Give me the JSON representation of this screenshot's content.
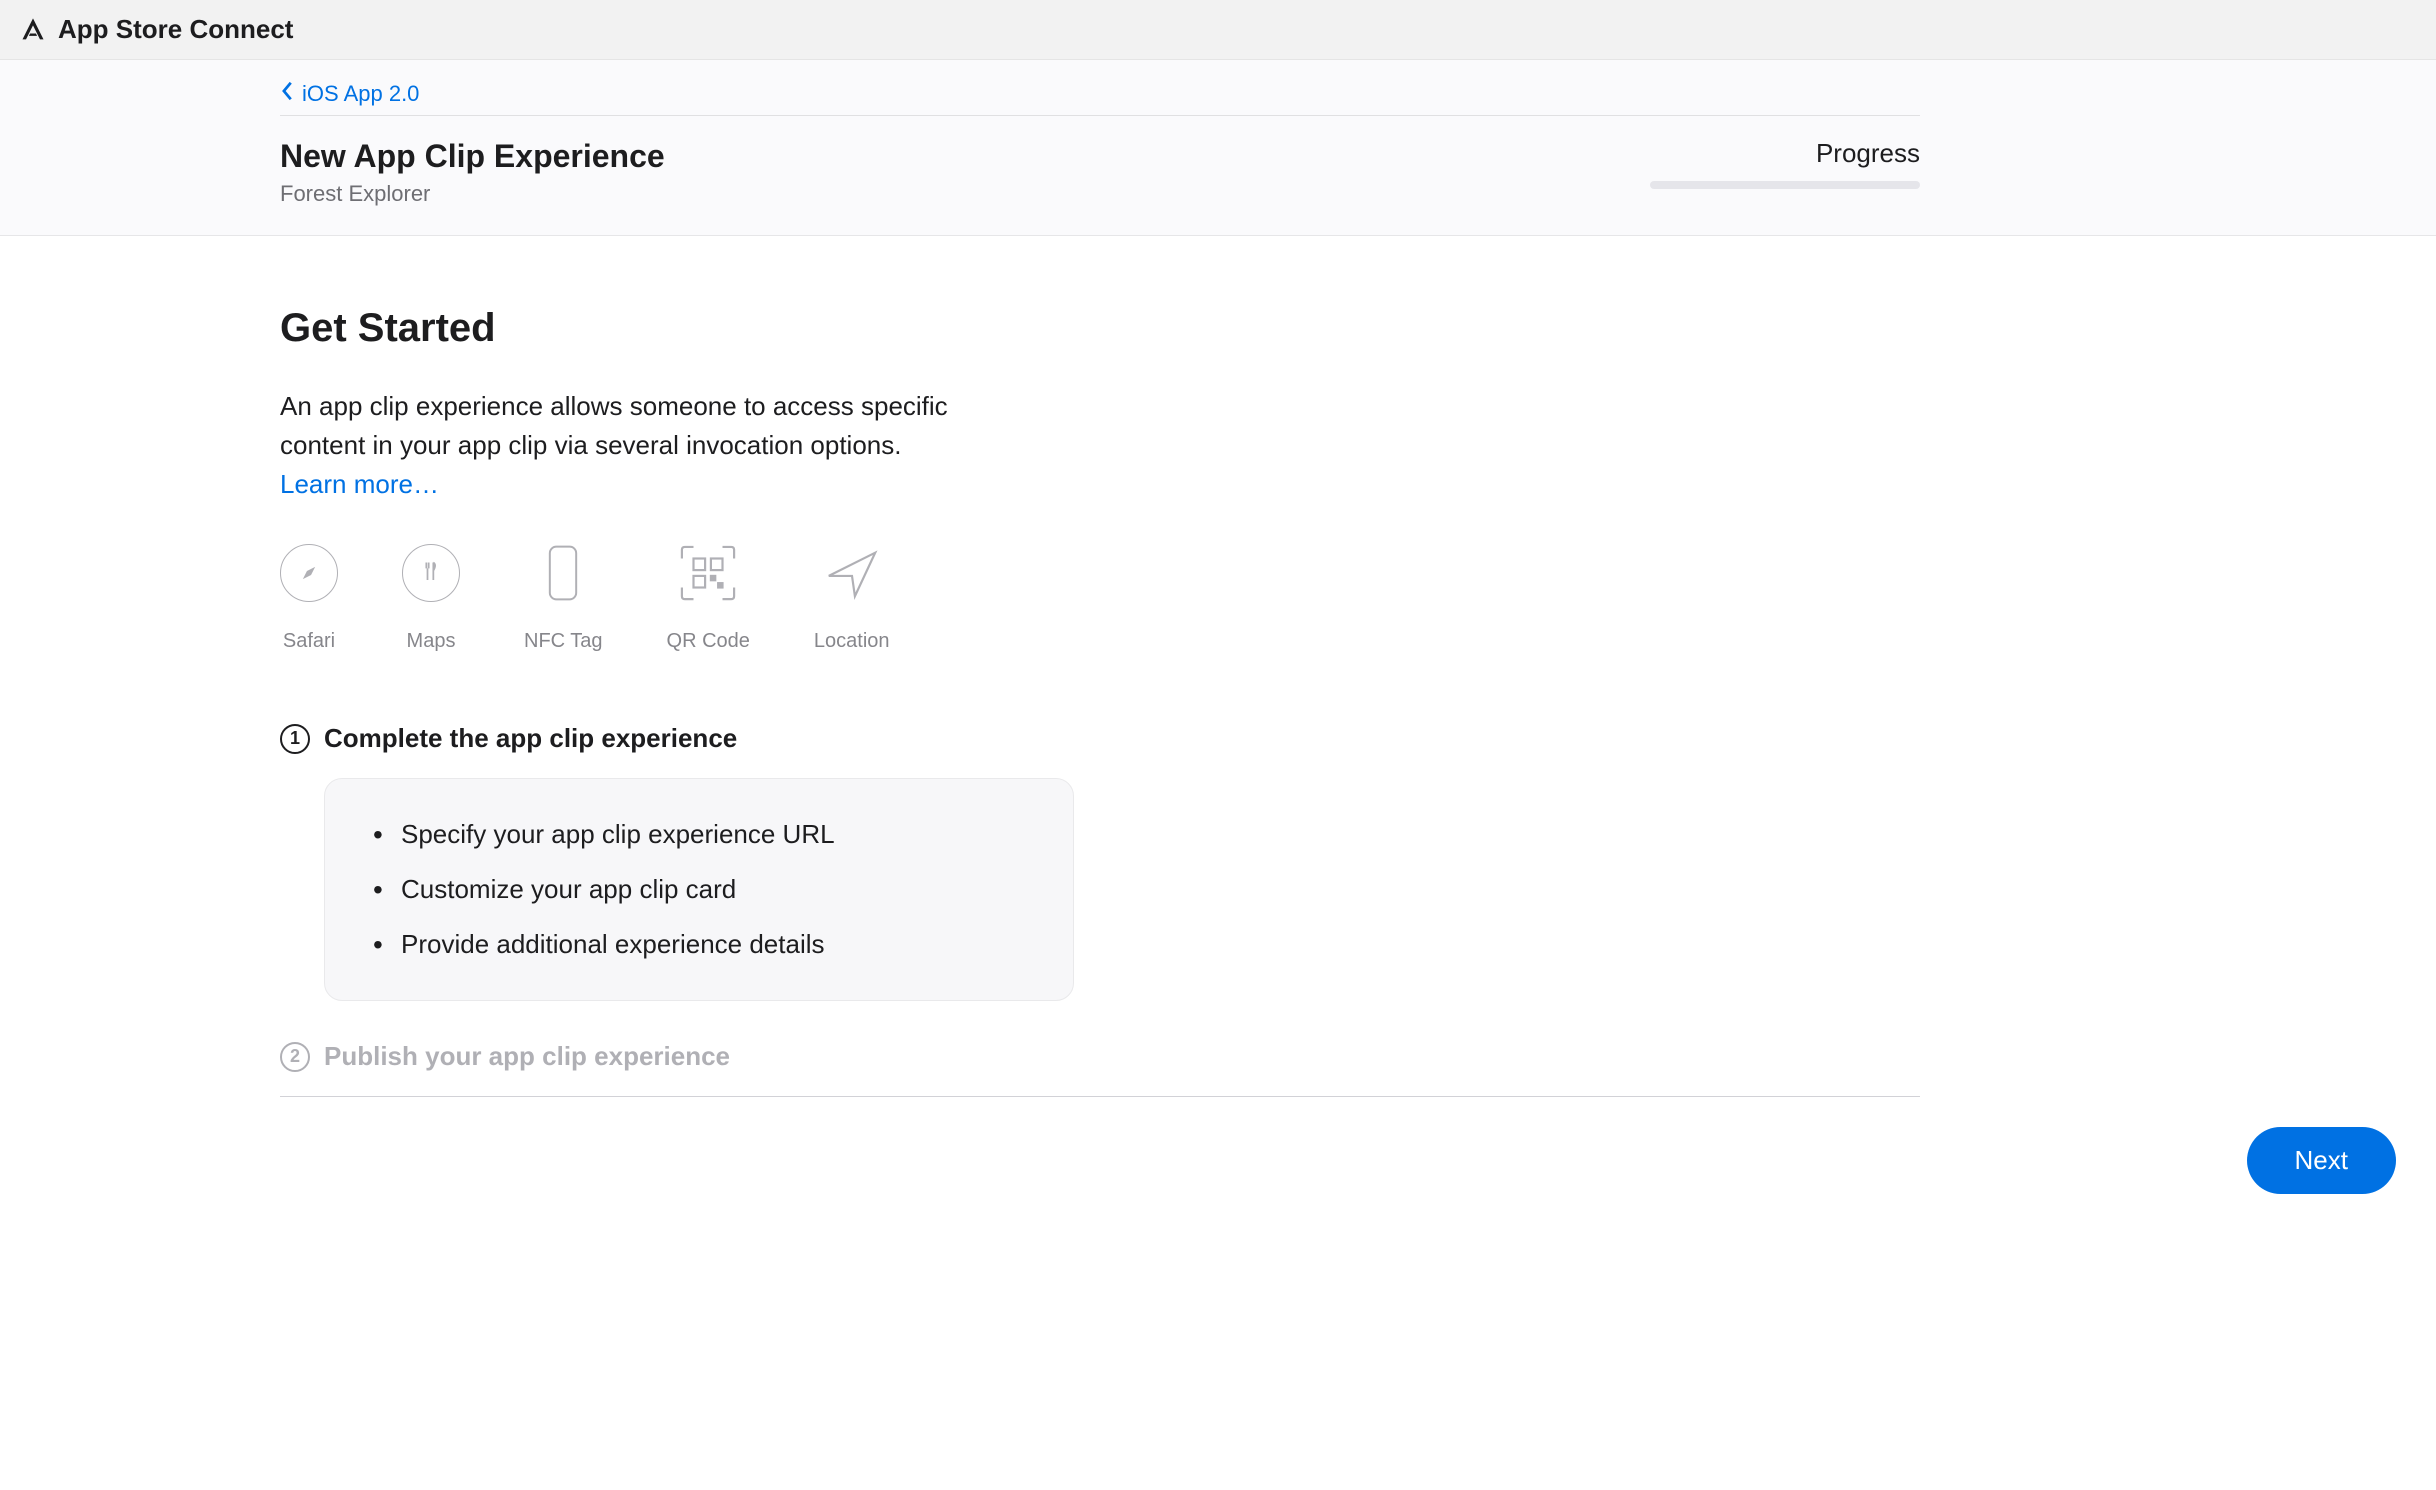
{
  "topbar": {
    "title": "App Store Connect"
  },
  "breadcrumb": {
    "back_label": "iOS App 2.0"
  },
  "header": {
    "title": "New App Clip Experience",
    "subtitle": "Forest Explorer",
    "progress_label": "Progress"
  },
  "getStarted": {
    "heading": "Get Started",
    "description": "An app clip experience allows someone to access specific content in your app clip via several invocation options.",
    "learn_more": "Learn more…"
  },
  "invocations": [
    {
      "icon": "compass-icon",
      "label": "Safari"
    },
    {
      "icon": "fork-knife-icon",
      "label": "Maps"
    },
    {
      "icon": "phone-icon",
      "label": "NFC Tag"
    },
    {
      "icon": "qrcode-icon",
      "label": "QR Code"
    },
    {
      "icon": "location-arrow-icon",
      "label": "Location"
    }
  ],
  "steps": {
    "step1": {
      "number": "1",
      "title": "Complete the app clip experience",
      "bullets": [
        "Specify your app clip experience URL",
        "Customize your app clip card",
        "Provide additional experience details"
      ]
    },
    "step2": {
      "number": "2",
      "title": "Publish your app clip experience"
    }
  },
  "footer": {
    "next": "Next"
  }
}
